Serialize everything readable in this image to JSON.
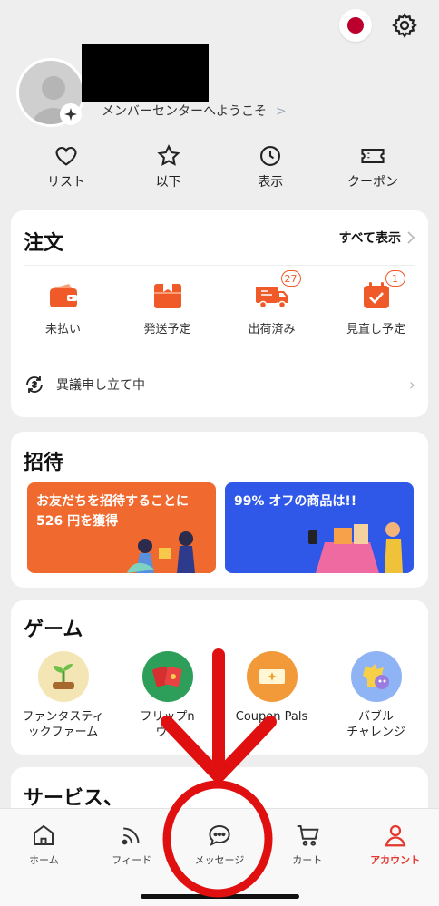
{
  "header": {
    "flag_icon": "japan-flag-icon",
    "settings_icon": "gear-icon"
  },
  "profile": {
    "welcome_text": "メンバーセンターへようこそ",
    "welcome_chevron": ">"
  },
  "quick_links": [
    {
      "label": "リスト",
      "icon": "heart-icon"
    },
    {
      "label": "以下",
      "icon": "star-icon"
    },
    {
      "label": "表示",
      "icon": "clock-icon"
    },
    {
      "label": "クーポン",
      "icon": "ticket-icon"
    }
  ],
  "orders": {
    "title": "注文",
    "see_all": "すべて表示",
    "items": [
      {
        "label": "未払い",
        "icon": "wallet-icon",
        "badge": ""
      },
      {
        "label": "発送予定",
        "icon": "box-icon",
        "badge": ""
      },
      {
        "label": "出荷済み",
        "icon": "truck-icon",
        "badge": "27"
      },
      {
        "label": "見直し予定",
        "icon": "review-icon",
        "badge": "1"
      }
    ],
    "dispute_label": "異議申し立て中"
  },
  "invite": {
    "title": "招待",
    "banner1_text": "お友だちを招待することに\n526 円を獲得",
    "banner2_text": "99% オフの商品は!!"
  },
  "games": {
    "title": "ゲーム",
    "items": [
      {
        "label": "ファンタスティ\nックファーム",
        "icon": "sprout-icon",
        "color": "#f7d56b"
      },
      {
        "label": "フリップn\nウィ",
        "icon": "cards-icon",
        "color": "#2e9f5a"
      },
      {
        "label": "Coupon Pals",
        "icon": "coupon-icon",
        "color": "#f29a3a"
      },
      {
        "label": "バブル\nチャレンジ",
        "icon": "bubble-icon",
        "color": "#7aa7f0"
      }
    ]
  },
  "services": {
    "title": "サービス、"
  },
  "tabbar": {
    "tabs": [
      {
        "label": "ホーム",
        "icon": "home-icon"
      },
      {
        "label": "フィード",
        "icon": "feed-icon"
      },
      {
        "label": "メッセージ",
        "icon": "message-icon"
      },
      {
        "label": "カート",
        "icon": "cart-icon"
      },
      {
        "label": "アカウント",
        "icon": "account-icon"
      }
    ],
    "active_index": 4
  },
  "colors": {
    "accent": "#f05a28",
    "active_tab": "#e4372e",
    "annotation": "#e01010"
  }
}
